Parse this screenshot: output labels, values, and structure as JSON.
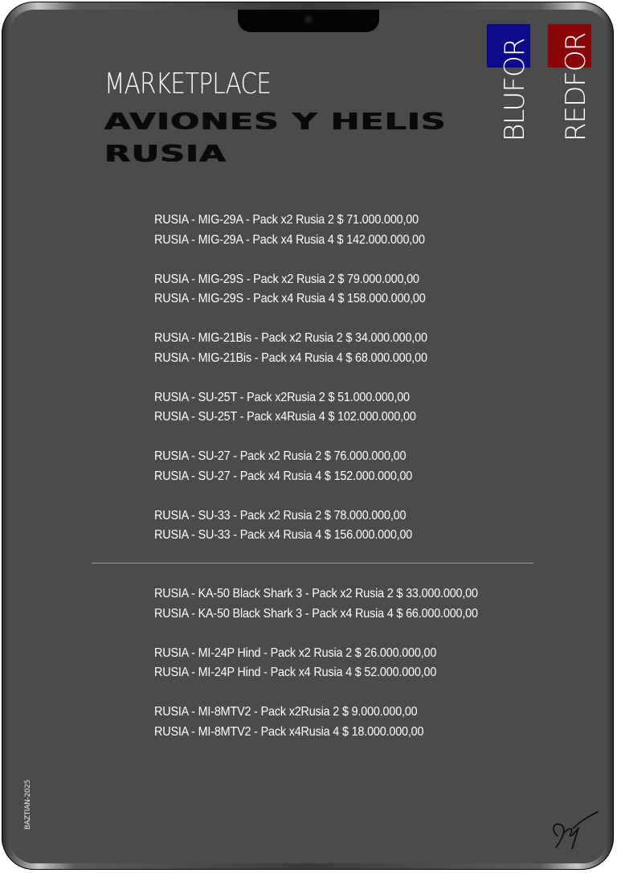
{
  "header": {
    "title": "MARKETPLACE",
    "subtitle_line1": "AVIONES Y HELIS",
    "subtitle_line2": "RUSIA"
  },
  "tabs": [
    {
      "label": "BLUFOR",
      "color": "#0a0a8a"
    },
    {
      "label": "REDFOR",
      "color": "#8a0606"
    }
  ],
  "planes": [
    {
      "rows": [
        "RUSIA - MIG-29A - Pack x2   Rusia 2   $ 71.000.000,00",
        "RUSIA - MIG-29A - Pack x4   Rusia 4   $ 142.000.000,00"
      ]
    },
    {
      "rows": [
        "RUSIA - MIG-29S - Pack x2   Rusia 2   $ 79.000.000,00",
        "RUSIA - MIG-29S - Pack x4   Rusia 4   $ 158.000.000,00"
      ]
    },
    {
      "rows": [
        "RUSIA - MIG-21Bis - Pack x2 Rusia 2   $ 34.000.000,00",
        "RUSIA - MIG-21Bis - Pack x4 Rusia 4   $ 68.000.000,00"
      ]
    },
    {
      "rows": [
        "RUSIA - SU-25T - Pack x2Rusia 2   $ 51.000.000,00",
        "RUSIA - SU-25T - Pack x4Rusia 4   $ 102.000.000,00"
      ]
    },
    {
      "rows": [
        "RUSIA - SU-27 - Pack x2  Rusia 2   $ 76.000.000,00",
        "RUSIA - SU-27 - Pack x4  Rusia 4   $ 152.000.000,00"
      ]
    },
    {
      "rows": [
        "RUSIA - SU-33 - Pack x2  Rusia 2   $ 78.000.000,00",
        "RUSIA - SU-33 - Pack x4  Rusia 4   $ 156.000.000,00"
      ]
    }
  ],
  "helis": [
    {
      "rows": [
        "RUSIA - KA-50 Black Shark 3 - Pack x2     Rusia 2   $ 33.000.000,00",
        "RUSIA - KA-50 Black Shark 3 - Pack x4     Rusia 4   $ 66.000.000,00"
      ]
    },
    {
      "rows": [
        "RUSIA - MI-24P Hind - Pack x2  Rusia 2   $ 26.000.000,00",
        "RUSIA - MI-24P Hind - Pack x4  Rusia 4   $ 52.000.000,00"
      ]
    },
    {
      "rows": [
        "RUSIA - MI-8MTV2 - Pack x2Rusia 2   $ 9.000.000,00",
        "RUSIA - MI-8MTV2 - Pack x4Rusia 4   $ 18.000.000,00"
      ]
    }
  ],
  "footer": {
    "credit": "BAZTIAN-2025"
  }
}
